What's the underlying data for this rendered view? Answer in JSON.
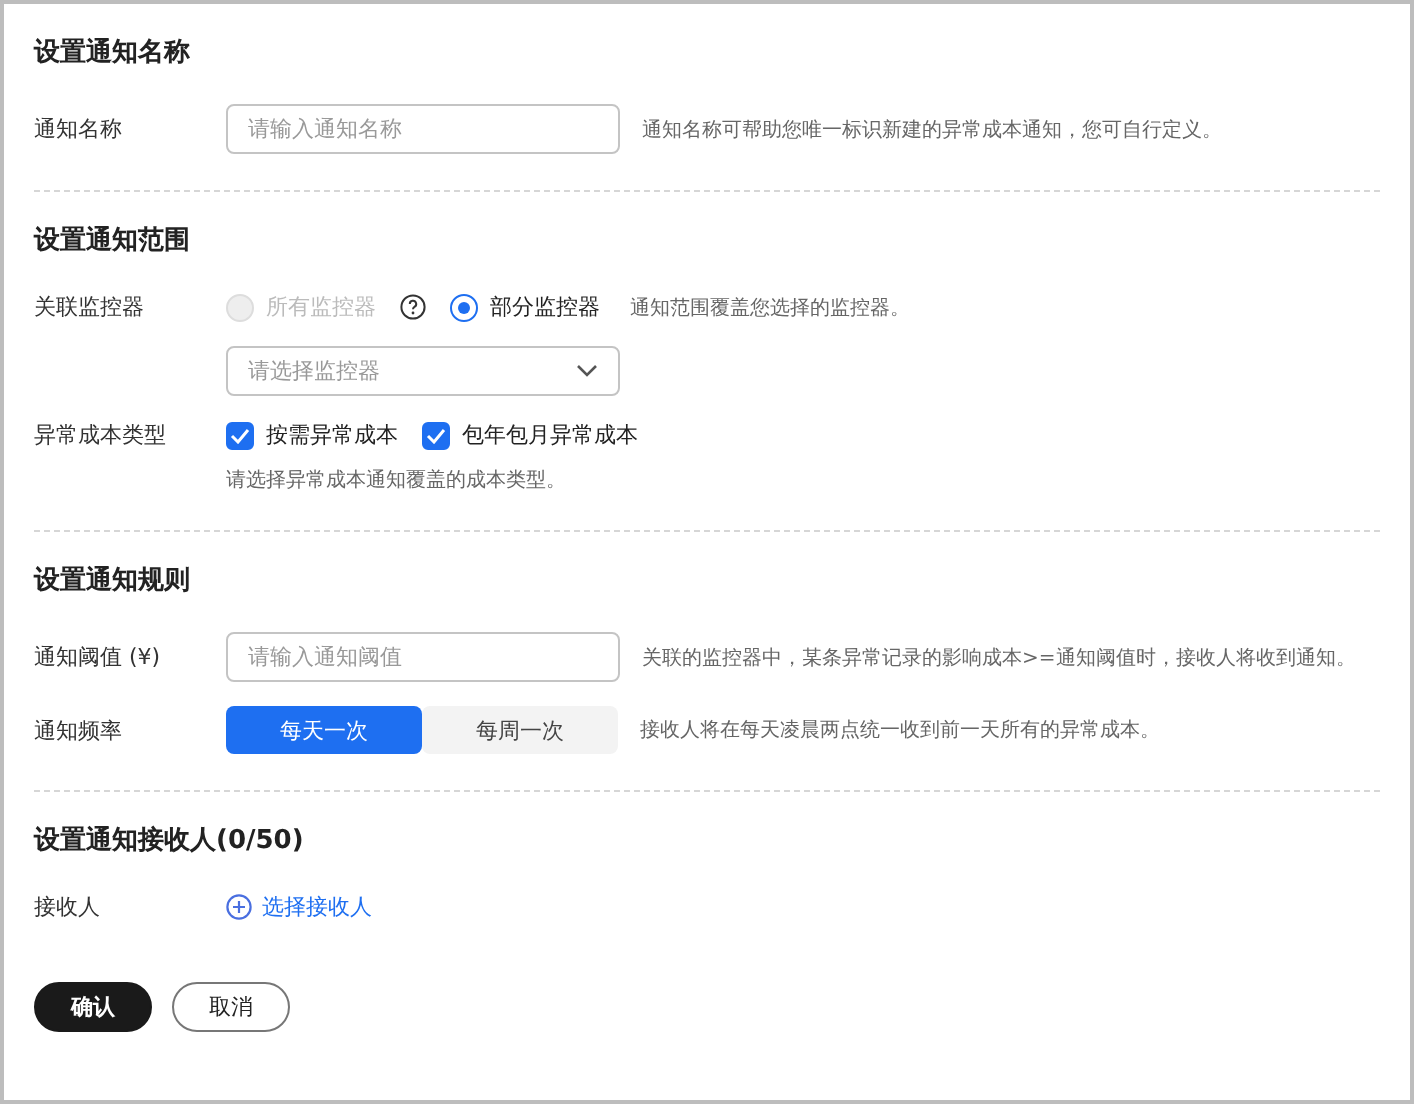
{
  "sections": [
    {
      "title": "设置通知名称",
      "rows": [
        {
          "kind": "input",
          "label": "通知名称",
          "placeholder": "请输入通知名称",
          "hint": "通知名称可帮助您唯一标识新建的异常成本通知，您可自行定义。"
        }
      ]
    },
    {
      "title": "设置通知范围",
      "rows": [
        {
          "kind": "radio",
          "label": "关联监控器",
          "options": [
            {
              "label": "所有监控器",
              "selected": false,
              "disabled": true,
              "help": true
            },
            {
              "label": "部分监控器",
              "selected": true,
              "disabled": false,
              "help": false
            }
          ],
          "hint": "通知范围覆盖您选择的监控器。"
        },
        {
          "kind": "select",
          "placeholder": "请选择监控器"
        },
        {
          "kind": "checkbox",
          "label": "异常成本类型",
          "options": [
            {
              "label": "按需异常成本",
              "checked": true
            },
            {
              "label": "包年包月异常成本",
              "checked": true
            }
          ],
          "note": "请选择异常成本通知覆盖的成本类型。"
        }
      ]
    },
    {
      "title": "设置通知规则",
      "rows": [
        {
          "kind": "input",
          "label": "通知阈值 (¥)",
          "placeholder": "请输入通知阈值",
          "hint": "关联的监控器中，某条异常记录的影响成本>=通知阈值时，接收人将收到通知。"
        },
        {
          "kind": "segmented",
          "label": "通知频率",
          "options": [
            {
              "label": "每天一次",
              "selected": true
            },
            {
              "label": "每周一次",
              "selected": false
            }
          ],
          "hint": "接收人将在每天凌晨两点统一收到前一天所有的异常成本。"
        }
      ]
    },
    {
      "title": "设置通知接收人(0/50)",
      "rows": [
        {
          "kind": "link",
          "label": "接收人",
          "link": "选择接收人"
        }
      ]
    }
  ],
  "buttons": [
    {
      "label": "确认",
      "kind": "primary"
    },
    {
      "label": "取消",
      "kind": "secondary"
    }
  ]
}
